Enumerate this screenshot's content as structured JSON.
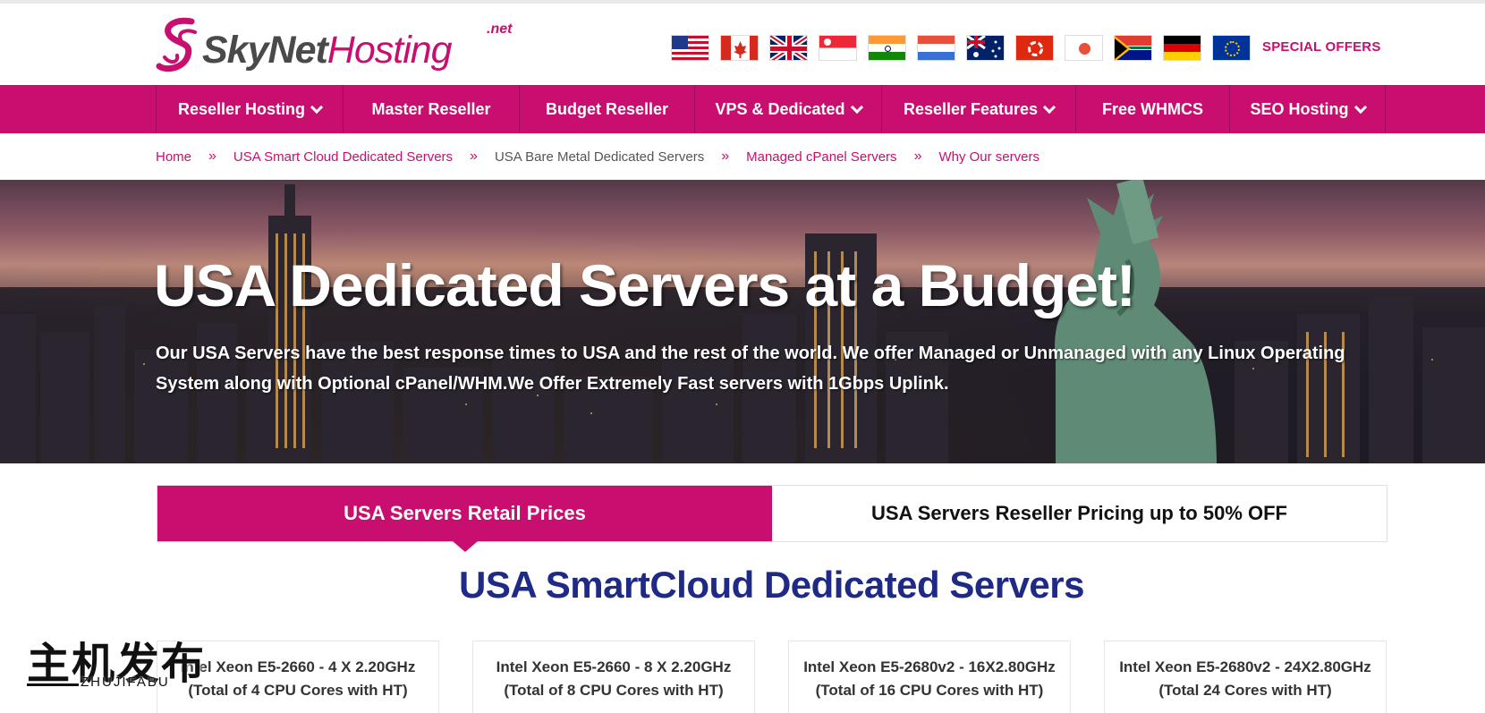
{
  "logo": {
    "name_part1": "SkyNet",
    "name_part2": "Hosting",
    "tld": ".net"
  },
  "flags": [
    "usa-flag",
    "canada-flag",
    "uk-flag",
    "singapore-flag",
    "india-flag",
    "netherlands-flag",
    "australia-flag",
    "hong-kong-flag",
    "japan-flag",
    "south-africa-flag",
    "germany-flag",
    "eu-flag"
  ],
  "special_offers": "SPECIAL OFFERS",
  "nav": [
    {
      "label": "Reseller Hosting",
      "dropdown": true
    },
    {
      "label": "Master Reseller",
      "dropdown": false
    },
    {
      "label": "Budget Reseller",
      "dropdown": false
    },
    {
      "label": "VPS & Dedicated",
      "dropdown": true
    },
    {
      "label": "Reseller Features",
      "dropdown": true
    },
    {
      "label": "Free WHMCS",
      "dropdown": false
    },
    {
      "label": "SEO Hosting",
      "dropdown": true
    }
  ],
  "breadcrumb": {
    "items": [
      "Home",
      "USA Smart Cloud Dedicated Servers",
      "USA Bare Metal Dedicated Servers",
      "Managed cPanel Servers",
      "Why Our servers"
    ],
    "separator": "»"
  },
  "hero": {
    "title": "USA Dedicated Servers at a Budget!",
    "text": "Our USA Servers have the best response times to USA and the rest of the world. We offer Managed or Unmanaged with any Linux Operating System along with Optional cPanel/WHM.We Offer Extremely Fast servers with 1Gbps Uplink."
  },
  "tabs": [
    {
      "label": "USA Servers Retail Prices",
      "active": true
    },
    {
      "label": "USA Servers Reseller Pricing up to 50% OFF",
      "active": false
    }
  ],
  "section_title": "USA SmartCloud Dedicated Servers",
  "cards": [
    {
      "line1": "Intel Xeon E5-2660 - 4 X 2.20GHz",
      "line2": "(Total of 4 CPU Cores with HT)"
    },
    {
      "line1": "Intel Xeon E5-2660 - 8 X 2.20GHz",
      "line2": "(Total of 8 CPU Cores with HT)"
    },
    {
      "line1": "Intel Xeon E5-2680v2 - 16X2.80GHz",
      "line2": "(Total of 16 CPU Cores with HT)"
    },
    {
      "line1": "Intel Xeon E5-2680v2 - 24X2.80GHz",
      "line2": "(Total 24 Cores with HT)"
    }
  ],
  "watermark": {
    "cn": "主机发布",
    "en": "ZHUJIFABU"
  },
  "colors": {
    "brand": "#c80f6f",
    "title_blue": "#1e2a86"
  }
}
